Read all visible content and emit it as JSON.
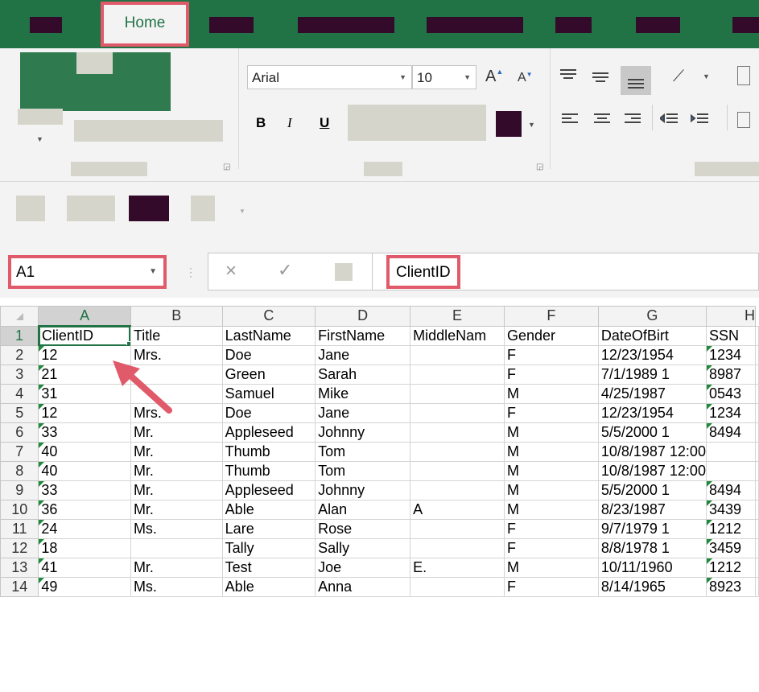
{
  "ribbon": {
    "home_tab": "Home",
    "font_name": "Arial",
    "font_size": "10",
    "bold": "B",
    "italic": "I",
    "underline": "U",
    "grow_font": "A",
    "shrink_font": "A"
  },
  "formula_bar": {
    "name_box": "A1",
    "formula": "ClientID",
    "cancel_icon": "×",
    "enter_icon": "✓"
  },
  "sheet": {
    "columns": [
      "A",
      "B",
      "C",
      "D",
      "E",
      "F",
      "G",
      "H"
    ],
    "rows": [
      {
        "n": "1",
        "cells": [
          "ClientID",
          "Title",
          "LastName",
          "FirstName",
          "MiddleNam",
          "Gender",
          "DateOfBirt",
          "SSN"
        ]
      },
      {
        "n": "2",
        "cells": [
          "12",
          "Mrs.",
          "Doe",
          "Jane",
          "",
          "F",
          "12/23/1954",
          "1234"
        ]
      },
      {
        "n": "3",
        "cells": [
          "21",
          "",
          "Green",
          "Sarah",
          "",
          "F",
          "7/1/1989 1",
          "8987"
        ]
      },
      {
        "n": "4",
        "cells": [
          "31",
          "",
          "Samuel",
          "Mike",
          "",
          "M",
          "4/25/1987",
          "0543"
        ]
      },
      {
        "n": "5",
        "cells": [
          "12",
          "Mrs.",
          "Doe",
          "Jane",
          "",
          "F",
          "12/23/1954",
          "1234"
        ]
      },
      {
        "n": "6",
        "cells": [
          "33",
          "Mr.",
          "Appleseed",
          "Johnny",
          "",
          "M",
          "5/5/2000 1",
          "8494"
        ]
      },
      {
        "n": "7",
        "cells": [
          "40",
          "Mr.",
          "Thumb",
          "Tom",
          "",
          "M",
          "10/8/1987 12:00",
          ""
        ]
      },
      {
        "n": "8",
        "cells": [
          "40",
          "Mr.",
          "Thumb",
          "Tom",
          "",
          "M",
          "10/8/1987 12:00",
          ""
        ]
      },
      {
        "n": "9",
        "cells": [
          "33",
          "Mr.",
          "Appleseed",
          "Johnny",
          "",
          "M",
          "5/5/2000 1",
          "8494"
        ]
      },
      {
        "n": "10",
        "cells": [
          "36",
          "Mr.",
          "Able",
          "Alan",
          "A",
          "M",
          "8/23/1987",
          "3439"
        ]
      },
      {
        "n": "11",
        "cells": [
          "24",
          "Ms.",
          "Lare",
          "Rose",
          "",
          "F",
          "9/7/1979 1",
          "1212"
        ]
      },
      {
        "n": "12",
        "cells": [
          "18",
          "",
          "Tally",
          "Sally",
          "",
          "F",
          "8/8/1978 1",
          "3459"
        ]
      },
      {
        "n": "13",
        "cells": [
          "41",
          "Mr.",
          "Test",
          "Joe",
          "E.",
          "M",
          "10/11/1960",
          "1212"
        ]
      },
      {
        "n": "14",
        "cells": [
          "49",
          "Ms.",
          "Able",
          "Anna",
          "",
          "F",
          "8/14/1965",
          "8923"
        ]
      }
    ]
  },
  "colors": {
    "accent_green": "#217346",
    "highlight_red": "#e05a6a",
    "tab_block": "#330a2a"
  }
}
